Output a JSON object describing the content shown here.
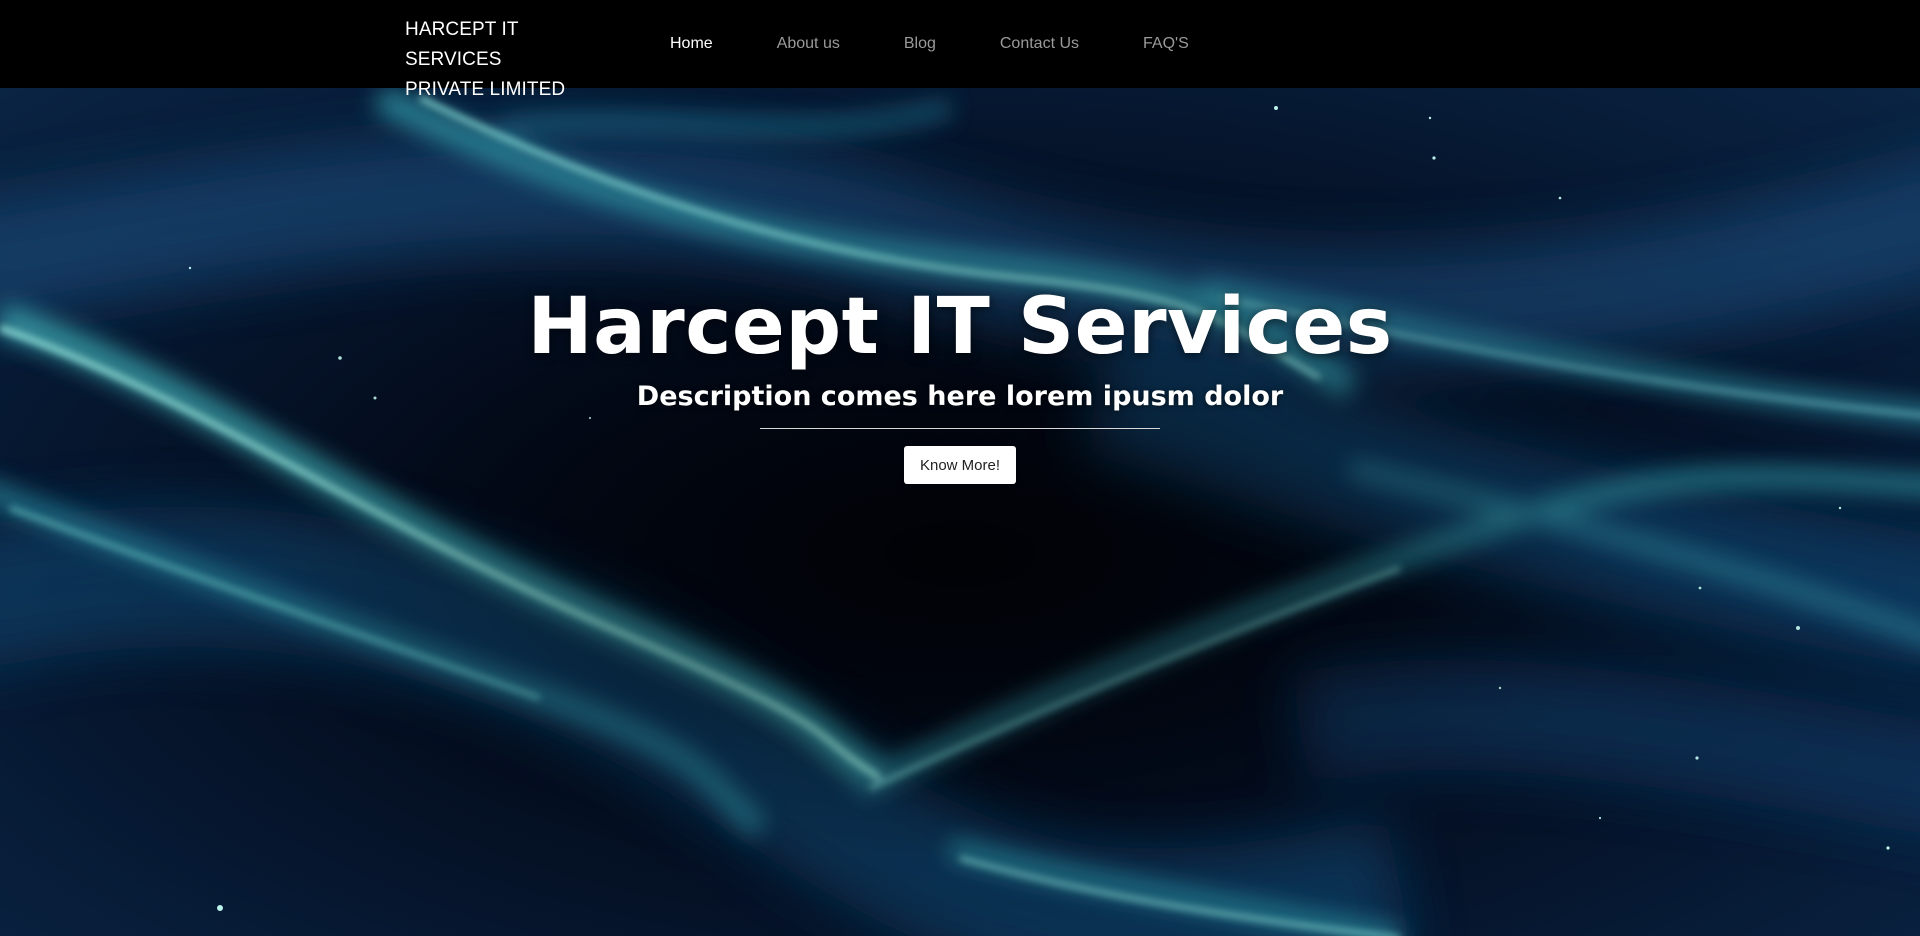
{
  "navbar": {
    "brand_line1": "HARCEPT IT SERVICES",
    "brand_line2": "PRIVATE LIMITED",
    "links": [
      {
        "label": "Home",
        "active": true
      },
      {
        "label": "About us",
        "active": false
      },
      {
        "label": "Blog",
        "active": false
      },
      {
        "label": "Contact Us",
        "active": false
      },
      {
        "label": "FAQ'S",
        "active": false
      }
    ]
  },
  "hero": {
    "title": "Harcept IT Services",
    "subtitle": "Description comes here lorem ipusm dolor",
    "button_label": "Know More!",
    "background": "dark blue particle waves"
  },
  "colors": {
    "navbar_bg": "#000000",
    "nav_active": "#ffffff",
    "nav_inactive": "#9a9a9a",
    "hero_base": "#030b1c",
    "particle_glow": "#5fd1cf"
  }
}
